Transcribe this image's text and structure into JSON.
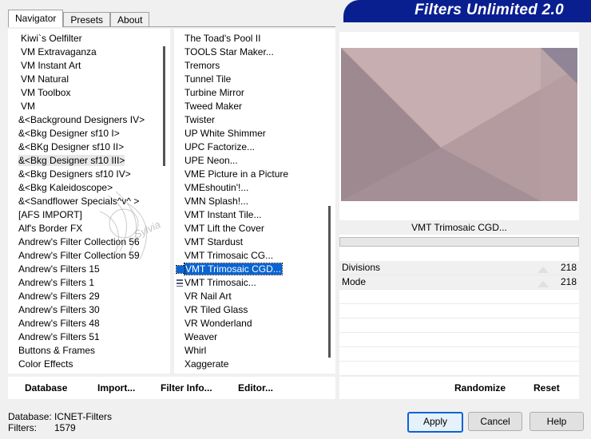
{
  "tabs": [
    "Navigator",
    "Presets",
    "About"
  ],
  "banner_title": "Filters Unlimited 2.0",
  "categories": [
    "Kiwi`s Oelfilter",
    "VM Extravaganza",
    "VM Instant Art",
    "VM Natural",
    "VM Toolbox",
    "VM",
    "&<Background Designers IV>",
    "&<Bkg Designer sf10 I>",
    "&<BKg Designer sf10 II>",
    "&<Bkg Designer sf10 III>",
    "&<Bkg Designers sf10 IV>",
    "&<Bkg Kaleidoscope>",
    "&<Sandflower Specials^v^ >",
    "[AFS IMPORT]",
    "Alf's Border FX",
    "Andrew's Filter Collection 56",
    "Andrew's Filter Collection 59",
    "Andrew's Filters 15",
    "Andrew's Filters 1",
    "Andrew's Filters 29",
    "Andrew's Filters 30",
    "Andrew's Filters 48",
    "Andrew's Filters 51",
    "Buttons & Frames",
    "Color Effects"
  ],
  "filters": [
    "The Toad's Pool II",
    "TOOLS Star Maker...",
    "Tremors",
    "Tunnel Tile",
    "Turbine Mirror",
    "Tweed Maker",
    "Twister",
    "UP White Shimmer",
    "UPC Factorize...",
    "UPE Neon...",
    "VME Picture in a Picture",
    "VMEshoutin'!...",
    "VMN Splash!...",
    "VMT Instant Tile...",
    "VMT Lift the Cover",
    "VMT Stardust",
    "VMT Trimosaic CG...",
    "VMT Trimosaic CGD...",
    "VMT Trimosaic...",
    "VR Nail Art",
    "VR Tiled Glass",
    "VR Wonderland",
    "Weaver",
    "Whirl",
    "Xaggerate"
  ],
  "selected_filter_name": "VMT Trimosaic CGD...",
  "params": [
    {
      "label": "Divisions",
      "value": "218"
    },
    {
      "label": "Mode",
      "value": "218"
    }
  ],
  "toolbar": {
    "database": "Database",
    "import": "Import...",
    "filter_info": "Filter Info...",
    "editor": "Editor...",
    "randomize": "Randomize",
    "reset": "Reset"
  },
  "status": {
    "database_label": "Database:",
    "database_value": "ICNET-Filters",
    "filters_label": "Filters:",
    "filters_value": "1579"
  },
  "buttons": {
    "apply": "Apply",
    "cancel": "Cancel",
    "help": "Help"
  },
  "watermark": "Sylvia",
  "colors": {
    "banner": "#0a1f8f",
    "selection": "#0a64d2",
    "preview_base": "#b29a9e"
  }
}
